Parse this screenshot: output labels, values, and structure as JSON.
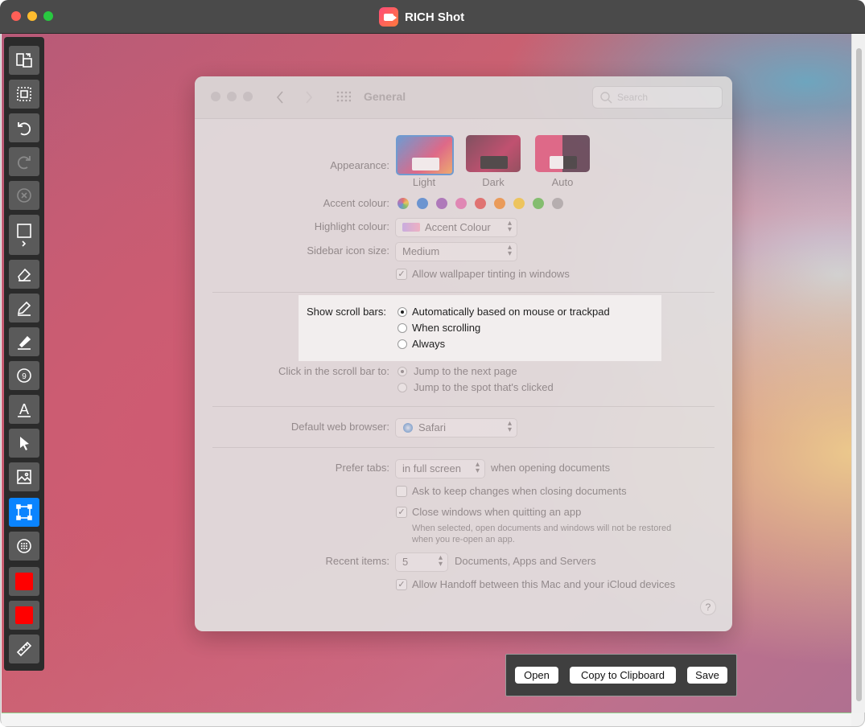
{
  "window": {
    "title": "RICH Shot"
  },
  "toolbar": {
    "tools": [
      "copy-screens-icon",
      "selection-frame-icon",
      "undo-icon",
      "redo-icon",
      "clear-icon",
      "rectangle-icon",
      "eraser-icon",
      "pencil-icon",
      "highlighter-icon",
      "counter-icon",
      "text-icon",
      "arrow-pointer-icon",
      "image-icon",
      "crop-selection-icon",
      "more-icon",
      "fill-color-swatch",
      "stroke-color-swatch",
      "ruler-icon"
    ],
    "counter_label": "9",
    "text_label": "A",
    "fill_color": "#ff0000",
    "stroke_color": "#ff0000",
    "active_color": "#0a84ff"
  },
  "prefs": {
    "title": "General",
    "search_placeholder": "Search",
    "appearance": {
      "label": "Appearance:",
      "options": [
        "Light",
        "Dark",
        "Auto"
      ]
    },
    "accent": {
      "label": "Accent colour:",
      "colors": [
        "#9a5fe0",
        "#3b82d6",
        "#9b59b6",
        "#e26fae",
        "#e2514e",
        "#f08b2c",
        "#f4c631",
        "#5dbb4a",
        "#a6a6a6"
      ]
    },
    "highlight": {
      "label": "Highlight colour:",
      "value": "Accent Colour"
    },
    "sidebar_icon": {
      "label": "Sidebar icon size:",
      "value": "Medium"
    },
    "wallpaper_tint": {
      "label": "Allow wallpaper tinting in windows",
      "checked": true
    },
    "scroll_bars": {
      "label": "Show scroll bars:",
      "options": [
        "Automatically based on mouse or trackpad",
        "When scrolling",
        "Always"
      ],
      "selected": 0
    },
    "click_scroll": {
      "label": "Click in the scroll bar to:",
      "options": [
        "Jump to the next page",
        "Jump to the spot that's clicked"
      ],
      "selected": 0
    },
    "browser": {
      "label": "Default web browser:",
      "value": "Safari"
    },
    "prefer_tabs": {
      "label": "Prefer tabs:",
      "value": "in full screen",
      "suffix": "when opening documents"
    },
    "ask_keep": {
      "label": "Ask to keep changes when closing documents",
      "checked": false
    },
    "close_windows": {
      "label": "Close windows when quitting an app",
      "checked": true,
      "note_line1": "When selected, open documents and windows will not be restored",
      "note_line2": "when you re-open an app."
    },
    "recent": {
      "label": "Recent items:",
      "value": "5",
      "suffix": "Documents, Apps and Servers"
    },
    "handoff": {
      "label": "Allow Handoff between this Mac and your iCloud devices",
      "checked": true
    },
    "help_label": "?"
  },
  "actions": {
    "open": "Open",
    "copy": "Copy to Clipboard",
    "save": "Save"
  }
}
